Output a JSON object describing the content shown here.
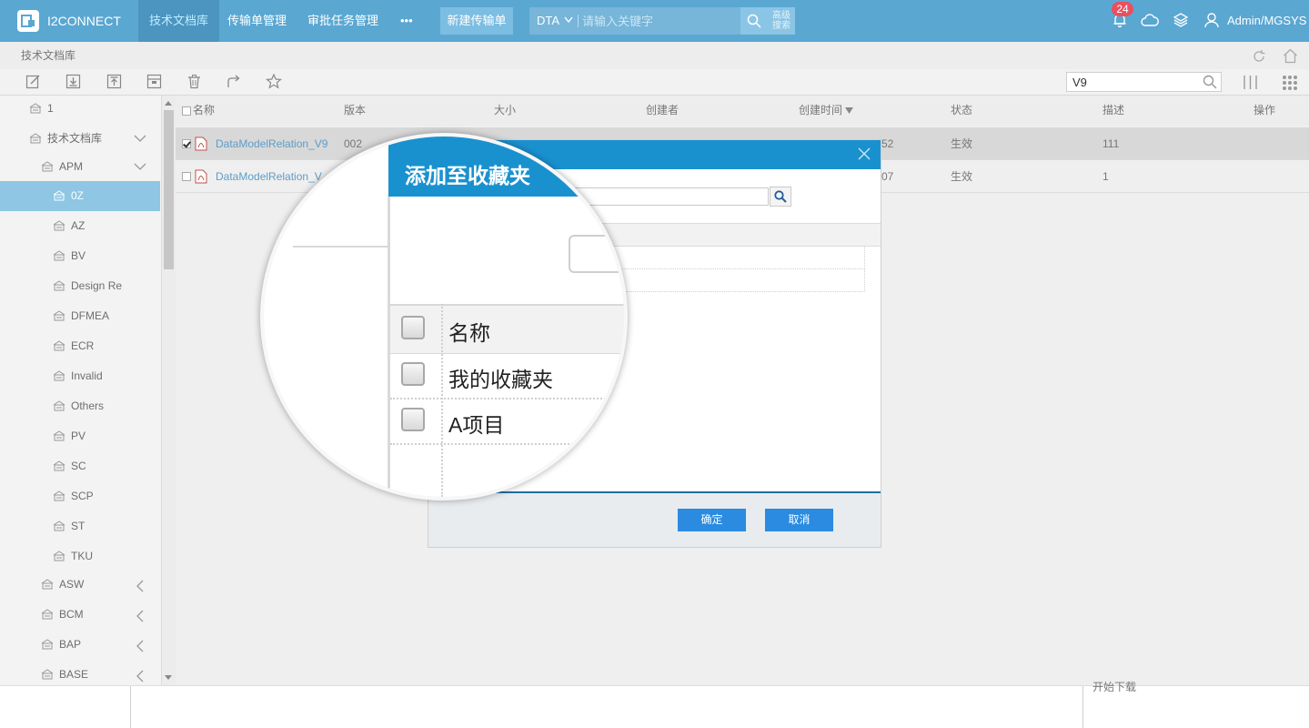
{
  "app": {
    "name": "I2CONNECT"
  },
  "nav": [
    {
      "label": "技术文档库"
    },
    {
      "label": "传输单管理"
    },
    {
      "label": "审批任务管理"
    },
    {
      "label": "•••"
    }
  ],
  "new_button": "新建传输单",
  "search": {
    "type": "DTA",
    "placeholder": "请输入关键字",
    "advanced": "高级搜索"
  },
  "notifications": {
    "count": "24"
  },
  "user": {
    "name": "Admin/MGSYS"
  },
  "breadcrumb": "技术文档库",
  "filter": {
    "value": "V9"
  },
  "tree": [
    {
      "label": "1"
    },
    {
      "label": "技术文档库"
    },
    {
      "label": "APM"
    },
    {
      "label": "0Z"
    },
    {
      "label": "AZ"
    },
    {
      "label": "BV"
    },
    {
      "label": "Design Re"
    },
    {
      "label": "DFMEA"
    },
    {
      "label": "ECR"
    },
    {
      "label": "Invalid"
    },
    {
      "label": "Others"
    },
    {
      "label": "PV"
    },
    {
      "label": "SC"
    },
    {
      "label": "SCP"
    },
    {
      "label": "ST"
    },
    {
      "label": "TKU"
    },
    {
      "label": "ASW"
    },
    {
      "label": "BCM"
    },
    {
      "label": "BAP"
    },
    {
      "label": "BASE"
    }
  ],
  "table": {
    "columns": [
      "名称",
      "版本",
      "大小",
      "创建者",
      "创建时间",
      "状态",
      "描述",
      "操作"
    ],
    "rows": [
      {
        "name": "DataModelRelation_V9",
        "version": "002",
        "time": "3:52",
        "status": "生效",
        "desc": "111"
      },
      {
        "name": "DataModelRelation_V",
        "version": "",
        "time": "4:07",
        "status": "生效",
        "desc": "1"
      }
    ]
  },
  "dialog": {
    "title": "添加至收藏夹",
    "list_header": "名称",
    "items": [
      "我的收藏夹",
      "A项目"
    ],
    "confirm": "确定",
    "cancel": "取消"
  },
  "bottom_label": "开始下载",
  "colors": {
    "topbar": "#5aa7d2",
    "active_nav": "#4c95c0",
    "dialog_header": "#1a91cf",
    "primary_button": "#2a8be0",
    "selected_tree": "#8ec6e4",
    "badge": "#e8505f"
  }
}
